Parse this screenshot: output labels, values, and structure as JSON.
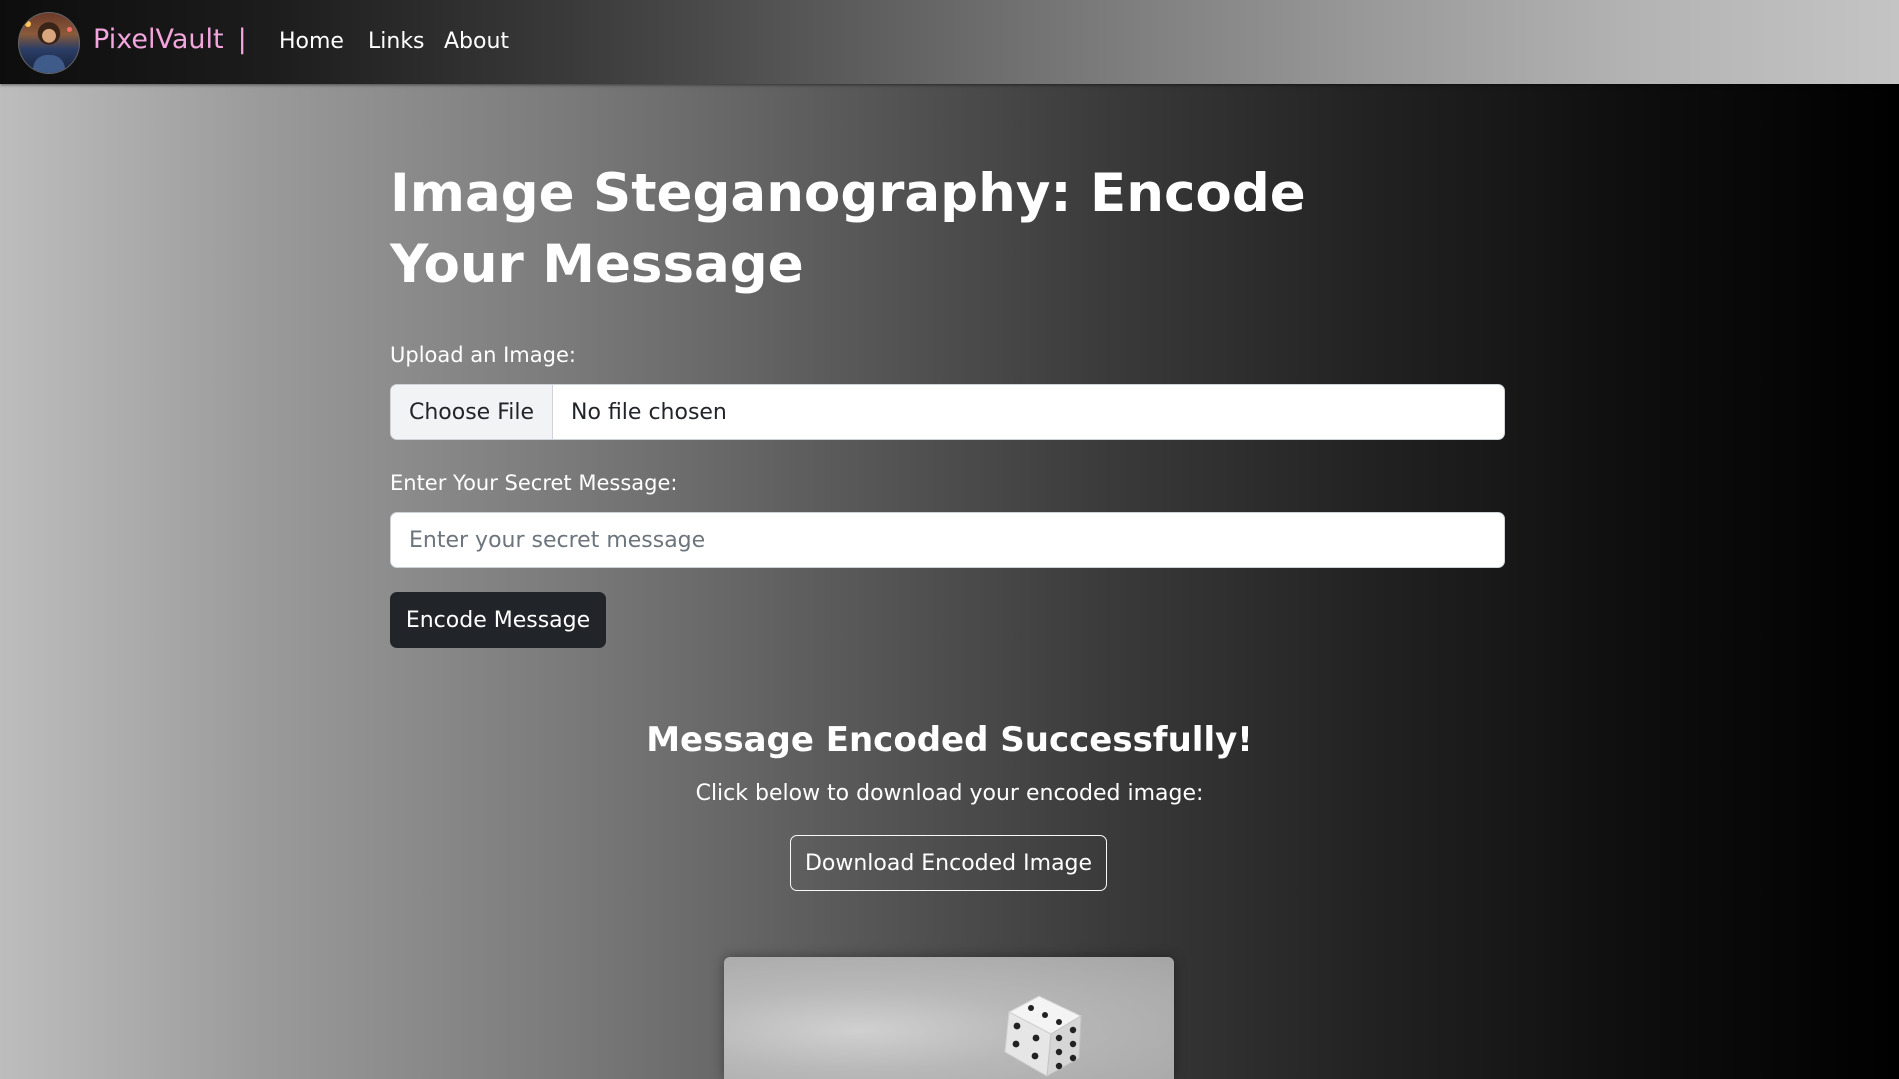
{
  "navbar": {
    "brand": "PixelVault",
    "separator": "|",
    "links": [
      "Home",
      "Links",
      "About"
    ]
  },
  "main": {
    "title": "Image Steganography: Encode Your Message",
    "upload_label": "Upload an Image:",
    "file_button": "Choose File",
    "file_status": "No file chosen",
    "message_label": "Enter Your Secret Message:",
    "message_placeholder": "Enter your secret message",
    "encode_button": "Encode Message"
  },
  "result": {
    "title": "Message Encoded Successfully!",
    "subtitle": "Click below to download your encoded image:",
    "download_button": "Download Encoded Image"
  },
  "colors": {
    "brand": "#f3a6dd",
    "button_dark": "#212529"
  }
}
